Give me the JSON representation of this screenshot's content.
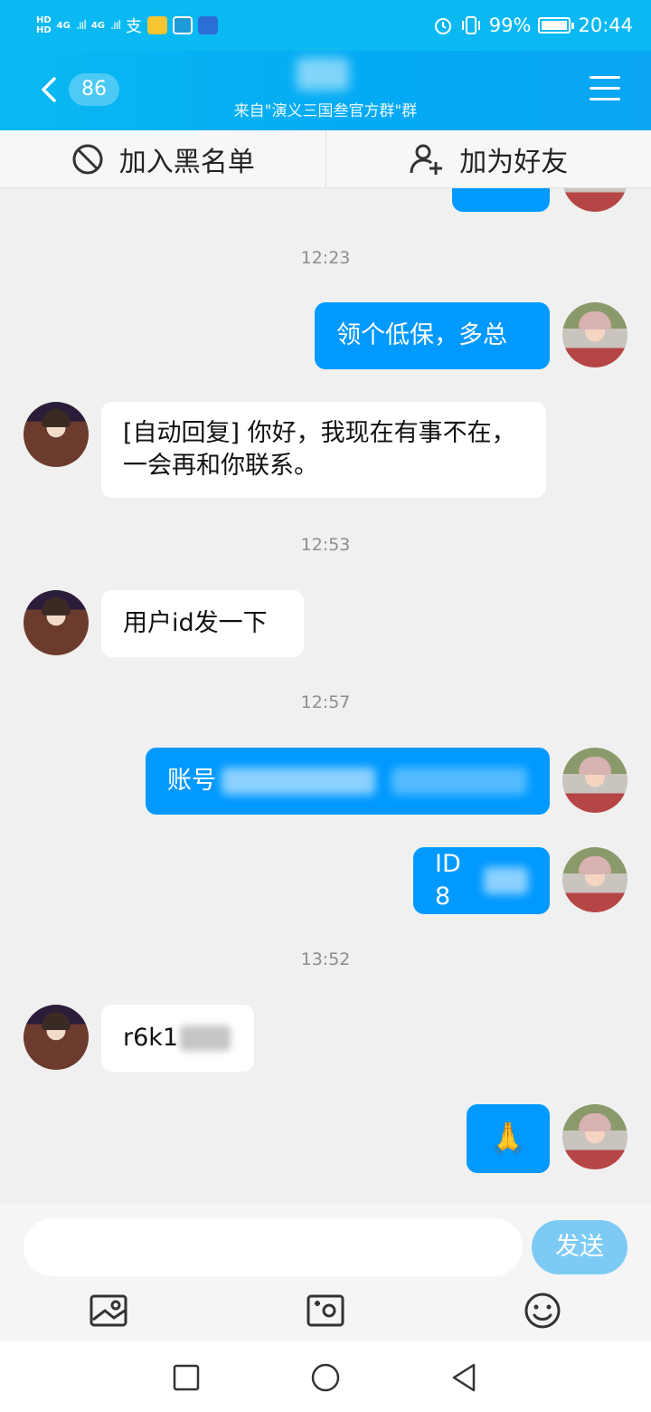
{
  "status_bar": {
    "hd_top": "HD",
    "hd_bottom": "HD",
    "net1": "4G",
    "net2": "4G",
    "signal_glyph": ".ııl",
    "alipay_glyph": "支",
    "battery_percent": "99%",
    "time": "20:44",
    "icons": [
      "alarm-icon",
      "vibrate-icon",
      "battery-icon",
      "mail-app-icon",
      "chat-app-icon",
      "tv-app-icon"
    ]
  },
  "header": {
    "unread_count": "86",
    "subtitle": "来自\"演义三国叁官方群\"群"
  },
  "actions": {
    "blacklist_label": "加入黑名单",
    "add_friend_label": "加为好友"
  },
  "messages": {
    "t1": "12:23",
    "m1": "领个低保，多总",
    "m2": "[自动回复] 你好，我现在有事不在，一会再和你联系。",
    "t2": "12:53",
    "m3": "用户id发一下",
    "t3": "12:57",
    "m4_prefix": "账号",
    "m5_prefix": "ID 8",
    "t4": "13:52",
    "m6_prefix": "r6k1",
    "m7_emoji": "🙏"
  },
  "input": {
    "placeholder": "",
    "send_label": "发送"
  }
}
